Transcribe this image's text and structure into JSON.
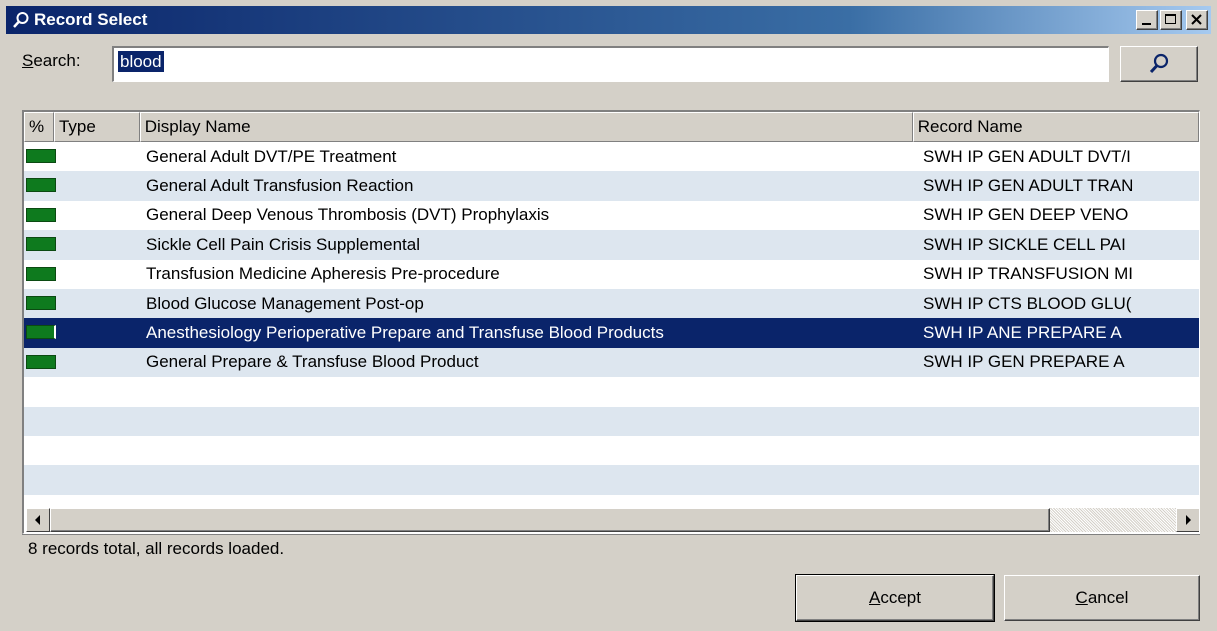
{
  "window": {
    "title": "Record Select",
    "title_icon": "search-icon",
    "controls": [
      "minimize",
      "maximize",
      "close"
    ]
  },
  "search": {
    "label": "Search:",
    "value": "blood",
    "button_icon": "search-icon"
  },
  "grid": {
    "columns": [
      "%",
      "Type",
      "Display Name",
      "Record Name"
    ],
    "rows": [
      {
        "display": "General Adult DVT/PE Treatment",
        "record": "SWH IP GEN ADULT DVT/I"
      },
      {
        "display": "General Adult Transfusion Reaction",
        "record": "SWH IP GEN ADULT TRAN"
      },
      {
        "display": "General Deep Venous Thrombosis (DVT) Prophylaxis",
        "record": "SWH IP GEN DEEP VENO"
      },
      {
        "display": "Sickle Cell Pain Crisis Supplemental",
        "record": "SWH IP SICKLE CELL PAI"
      },
      {
        "display": "Transfusion Medicine Apheresis Pre-procedure",
        "record": "SWH IP TRANSFUSION MI"
      },
      {
        "display": "Blood Glucose Management Post-op",
        "record": "SWH IP CTS BLOOD GLU("
      },
      {
        "display": "Anesthesiology Perioperative Prepare and Transfuse Blood Products",
        "record": "SWH IP ANE PREPARE A"
      },
      {
        "display": "General Prepare & Transfuse Blood Product",
        "record": "SWH IP GEN PREPARE A"
      }
    ],
    "selected_index": 6,
    "match_bar_color": "#0e7a1e",
    "alt_row_color": "#dde6ef",
    "selection_color": "#0a246a"
  },
  "status": {
    "text": "8 records total, all records loaded."
  },
  "buttons": {
    "accept": "Accept",
    "cancel": "Cancel"
  }
}
